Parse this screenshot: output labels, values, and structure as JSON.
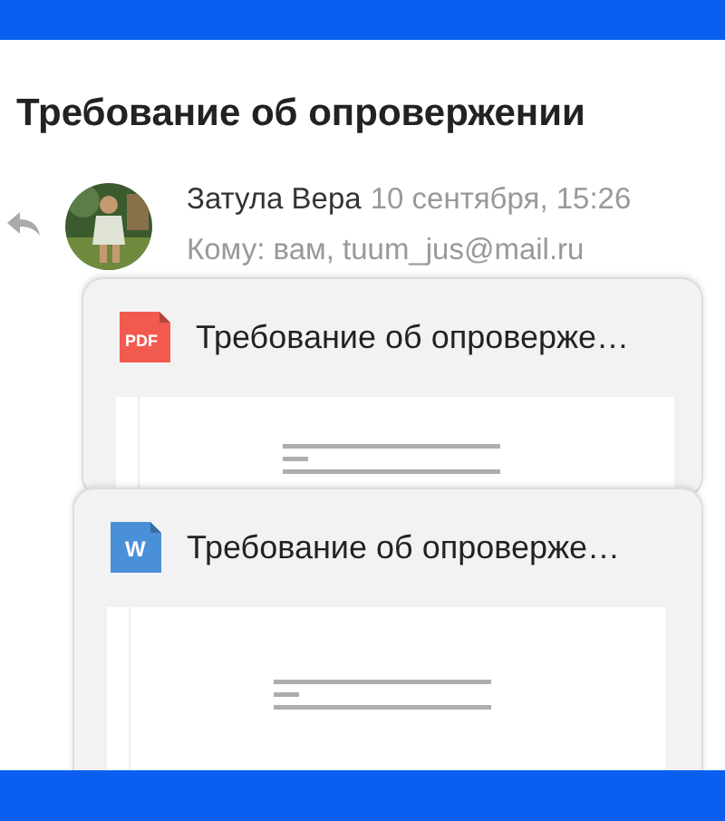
{
  "subject": "Требование об опровержении",
  "message": {
    "sender": "Затула Вера",
    "date": "10 сентября, 15:26",
    "recipients": "Кому: вам, tuum_jus@mail.ru"
  },
  "attachments": [
    {
      "kind": "pdf",
      "badge": "PDF",
      "name": "Требование об опроверже…"
    },
    {
      "kind": "word",
      "badge": "W",
      "name": "Требование об опроверже…"
    }
  ]
}
